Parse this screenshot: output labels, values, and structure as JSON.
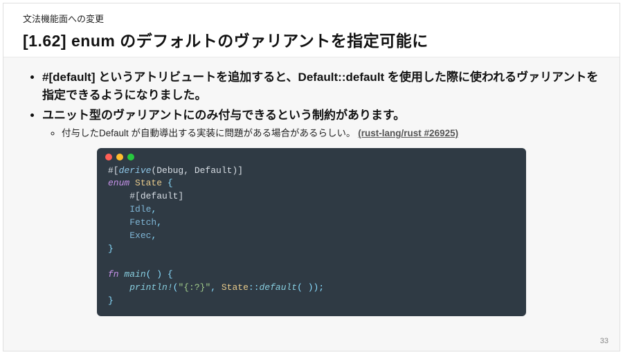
{
  "header": {
    "supertitle": "文法機能面への変更",
    "title": "[1.62] enum のデフォルトのヴァリアントを指定可能に"
  },
  "bullets": {
    "item1": "#[default] というアトリビュートを追加すると、Default::default を使用した際に使われるヴァリアントを指定できるようになりました。",
    "item2": "ユニット型のヴァリアントにのみ付与できるという制約があります。",
    "sub1_prefix": "付与したDefault が自動導出する実装に問題がある場合があるらしい。",
    "sub1_link_text": "(rust-lang/rust #26925)"
  },
  "code": {
    "line1_attr_open": "#[",
    "line1_derive": "derive",
    "line1_args": "(Debug, Default)",
    "line1_attr_close": "]",
    "line2_kw": "enum",
    "line2_type": "State",
    "line2_brace": " {",
    "line3_attr": "#[default]",
    "line4": "Idle",
    "line5": "Fetch",
    "line6": "Exec",
    "comma": ",",
    "rbrace": "}",
    "blank": "",
    "line8_fn": "fn",
    "line8_main": "main",
    "line8_sig": "( ) {",
    "line9_macro": "println!",
    "line9_open": "(",
    "line9_str": "\"{:?}\"",
    "line9_mid": ", ",
    "line9_type": "State",
    "line9_sep": "::",
    "line9_call": "default",
    "line9_close": "( ));",
    "line10": "}"
  },
  "page_number": "33"
}
